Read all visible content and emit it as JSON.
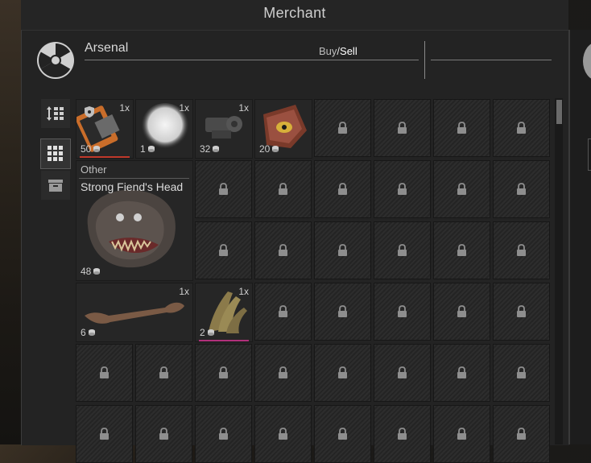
{
  "window": {
    "title": "Merchant"
  },
  "merchant": {
    "name": "Arsenal"
  },
  "trade_mode": {
    "buy": "Buy",
    "separator": "/",
    "sell": "Sell"
  },
  "sidebar": {
    "sort_icon": "sort-grid-icon",
    "grid_view_icon": "grid-view-icon",
    "storage_icon": "storage-box-icon"
  },
  "items": [
    {
      "name": "Tablet Device",
      "qty": "1x",
      "price": "50",
      "accent": "#c0392b"
    },
    {
      "name": "Pale Orb",
      "qty": "1x",
      "price": "1",
      "accent": "#6a6a6a"
    },
    {
      "name": "Mechanical Parts",
      "qty": "1x",
      "price": "32",
      "accent": "#6a6a6a"
    },
    {
      "name": "Eye Chunk",
      "qty": "",
      "price": "20",
      "accent": "#6a6a6a"
    },
    {
      "name": "Strong Fiend's Head",
      "category": "Other",
      "qty": "",
      "price": "48",
      "accent": "#6a6a6a"
    },
    {
      "name": "Bone",
      "qty": "1x",
      "price": "6",
      "accent": "#6a6a6a"
    },
    {
      "name": "Claw",
      "qty": "1x",
      "price": "2",
      "accent": "#b0307a"
    }
  ],
  "tooltip": {
    "category": "Other",
    "name": "Strong Fiend's Head"
  },
  "icons": {
    "lock": "lock-icon",
    "currency": "currency-icon"
  },
  "colors": {
    "panel": "#232323",
    "slot": "#2a2a2a",
    "text": "#d6d6d6"
  }
}
